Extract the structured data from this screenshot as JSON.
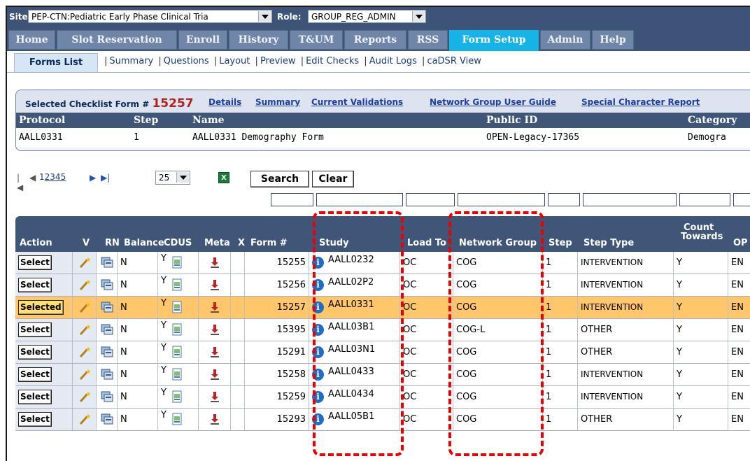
{
  "topbar": {
    "site_label": "Site:",
    "site_value": "PEP-CTN:Pediatric Early Phase Clinical Tria",
    "role_label": "Role:",
    "role_value": "GROUP_REG_ADMIN"
  },
  "tabs": [
    "Home",
    "Slot Reservation",
    "Enroll",
    "History",
    "T&UM",
    "Reports",
    "RSS",
    "Form Setup",
    "Admin",
    "Help"
  ],
  "active_tab": "Form Setup",
  "subnav": {
    "active": "Forms List",
    "links": [
      "Summary",
      "Questions",
      "Layout",
      "Preview",
      "Edit Checks",
      "Audit Logs",
      "caDSR View"
    ]
  },
  "checklist": {
    "label": "Selected Checklist Form #",
    "form_number": "15257",
    "links": [
      "Details",
      "Summary",
      "Current Validations",
      "Network Group User Guide",
      "Special Character Report"
    ],
    "columns": [
      "Protocol",
      "Step",
      "Name",
      "Public ID",
      "Category"
    ],
    "values": [
      "AALL0331",
      "1",
      "AALL0331 Demography Form",
      "OPEN-Legacy-17365",
      "Demogra"
    ]
  },
  "pager": {
    "pages": [
      "1",
      "2",
      "3",
      "4",
      "5"
    ],
    "page_size": "25",
    "search_label": "Search",
    "clear_label": "Clear",
    "excel_icon": "excel-export-icon"
  },
  "grid": {
    "headers": {
      "action": "Action",
      "v": "V",
      "rn": "RN",
      "balance": "Balance",
      "cdus": "CDUS",
      "meta": "Meta",
      "x": "X",
      "form": "Form #",
      "study": "Study",
      "load": "Load To",
      "network": "Network Group",
      "step": "Step",
      "step_type": "Step Type",
      "count1": "Count",
      "count2": "Towards",
      "op": "OP"
    },
    "rows": [
      {
        "action": "Select",
        "balance": "N",
        "cdus": "Y",
        "form": "15255",
        "study": "AALL0232",
        "load": "OC",
        "network": "COG",
        "step": "1",
        "step_type": "INTERVENTION",
        "count": "Y",
        "op": "EN"
      },
      {
        "action": "Select",
        "balance": "N",
        "cdus": "Y",
        "form": "15256",
        "study": "AALL02P2",
        "load": "OC",
        "network": "COG",
        "step": "1",
        "step_type": "INTERVENTION",
        "count": "Y",
        "op": "EN"
      },
      {
        "action": "Selected",
        "balance": "N",
        "cdus": "Y",
        "form": "15257",
        "study": "AALL0331",
        "load": "OC",
        "network": "COG",
        "step": "1",
        "step_type": "INTERVENTION",
        "count": "Y",
        "op": "EN"
      },
      {
        "action": "Select",
        "balance": "N",
        "cdus": "Y",
        "form": "15395",
        "study": "AALL03B1",
        "load": "OC",
        "network": "COG-L",
        "step": "1",
        "step_type": "OTHER",
        "count": "Y",
        "op": "EN"
      },
      {
        "action": "Select",
        "balance": "N",
        "cdus": "Y",
        "form": "15291",
        "study": "AALL03N1",
        "load": "OC",
        "network": "COG",
        "step": "1",
        "step_type": "OTHER",
        "count": "Y",
        "op": "EN"
      },
      {
        "action": "Select",
        "balance": "N",
        "cdus": "Y",
        "form": "15258",
        "study": "AALL0433",
        "load": "OC",
        "network": "COG",
        "step": "1",
        "step_type": "INTERVENTION",
        "count": "Y",
        "op": "EN"
      },
      {
        "action": "Select",
        "balance": "N",
        "cdus": "Y",
        "form": "15259",
        "study": "AALL0434",
        "load": "OC",
        "network": "COG",
        "step": "1",
        "step_type": "INTERVENTION",
        "count": "Y",
        "op": "EN"
      },
      {
        "action": "Select",
        "balance": "N",
        "cdus": "Y",
        "form": "15293",
        "study": "AALL05B1",
        "load": "OC",
        "network": "COG",
        "step": "1",
        "step_type": "OTHER",
        "count": "Y",
        "op": "EN"
      }
    ]
  },
  "colors": {
    "nav_bg": "#3d5478",
    "active_tab": "#16b4e6",
    "selected_row": "#ffc76a",
    "highlight_box": "#e00000"
  }
}
